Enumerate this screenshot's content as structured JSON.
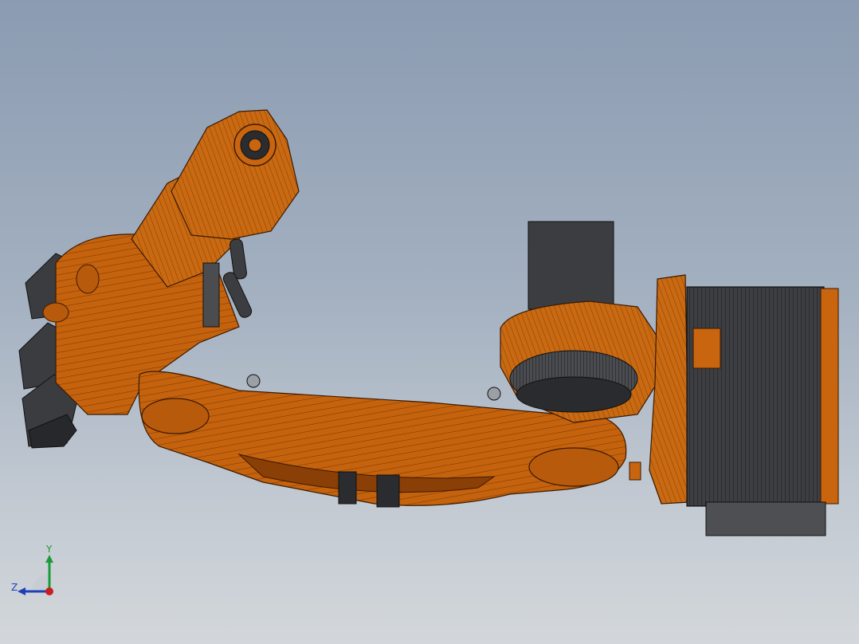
{
  "viewport": {
    "background_top": "#8b9bb1",
    "background_bottom": "#d3d7db"
  },
  "model": {
    "body_color": "#c8650e",
    "body_dark": "#8a3f06",
    "body_edge": "#3a1a02",
    "motor_color": "#3b3d40",
    "motor_dark": "#1e1f21"
  },
  "triad": {
    "y_label": "Y",
    "z_label": "Z",
    "y_color": "#1a9b3a",
    "z_color": "#1f3fb8",
    "x_color": "#c81e1e"
  }
}
